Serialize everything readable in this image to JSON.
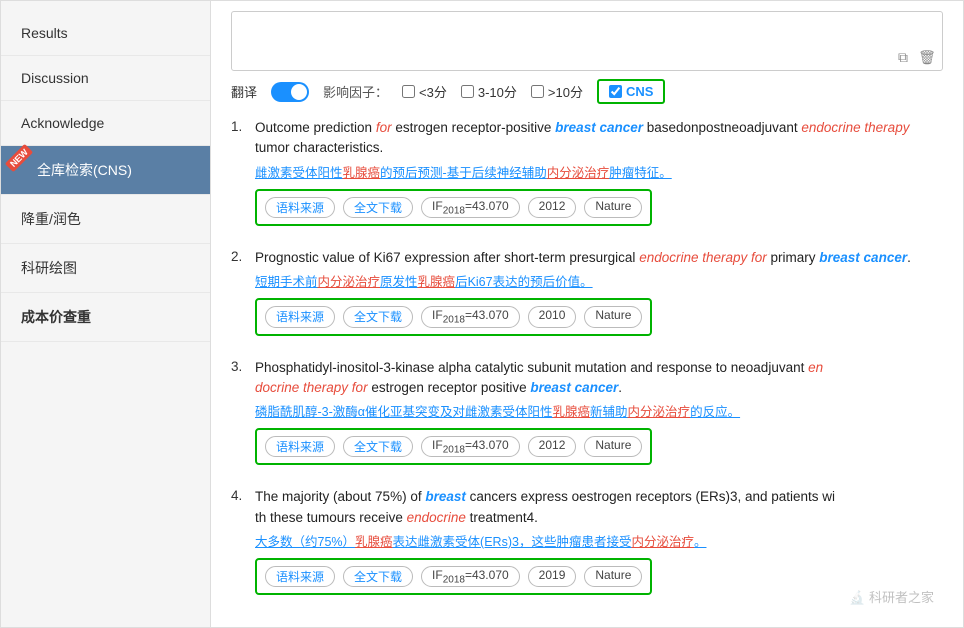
{
  "sidebar": {
    "items": [
      {
        "label": "Results",
        "active": false,
        "bold": false,
        "new": false
      },
      {
        "label": "Discussion",
        "active": false,
        "bold": false,
        "new": false
      },
      {
        "label": "Acknowledge",
        "active": false,
        "bold": false,
        "new": false
      },
      {
        "label": "全库检索(CNS)",
        "active": true,
        "bold": false,
        "new": true
      },
      {
        "label": "降重/润色",
        "active": false,
        "bold": false,
        "new": false
      },
      {
        "label": "科研绘图",
        "active": false,
        "bold": false,
        "new": false
      },
      {
        "label": "成本价查重",
        "active": false,
        "bold": true,
        "new": false
      }
    ]
  },
  "filter": {
    "translate_label": "翻译",
    "impact_label": "影响因子：",
    "lt3_label": "<3分",
    "range_label": "3-10分",
    "gt10_label": ">10分",
    "cns_label": "CNS",
    "cns_checked": true,
    "lt3_checked": false,
    "range_checked": false,
    "gt10_checked": false
  },
  "results": [
    {
      "title_before": "Outcome prediction ",
      "title_italic_red": "for",
      "title_mid1": " estrogen receptor-positive ",
      "title_italic_blue": "breast cancer",
      "title_mid2": " basedonpostneoadjuvant ",
      "title_red_italic": "endocrine therapy",
      "title_end": " tumor characteristics.",
      "cn_text": "雌激素受体阳性",
      "cn_red": "乳腺癌",
      "cn_mid": "的预后预测-基于后续神经辅助",
      "cn_red2": "内分泌治疗",
      "cn_end": "肿瘤特征。",
      "tags": [
        "语料来源",
        "全文下载",
        "IF2018=43.070",
        "2012",
        "Nature"
      ]
    },
    {
      "title_before": "Prognostic value of Ki67 expression after short-term presurgical ",
      "title_italic_red2": "endocrine therapy for",
      "title_mid1": " primary ",
      "title_italic_blue": "breast cancer",
      "title_end": ".",
      "cn_text": "短期手术前",
      "cn_red": "内分泌治疗",
      "cn_mid": "原发性",
      "cn_red2": "乳腺癌",
      "cn_end": "后Ki67表达的预后价值。",
      "tags": [
        "语料来源",
        "全文下载",
        "IF2018=43.070",
        "2010",
        "Nature"
      ]
    },
    {
      "title_before": "Phosphatidyl-inositol-3-kinase alpha catalytic subunit mutation and response to neoadjuvant ",
      "title_italic_red2": "en docrine therapy for",
      "title_mid1": " estrogen receptor positive ",
      "title_italic_blue": "breast cancer",
      "title_end": ".",
      "cn_text": "磷脂酰肌醇-3-激酶α催化亚基突变及对雌激素受体阳性",
      "cn_red2": "乳腺癌",
      "cn_mid2": "新辅助",
      "cn_red3": "内分泌治疗",
      "cn_end": "的反应。",
      "tags": [
        "语料来源",
        "全文下载",
        "IF2018=43.070",
        "2012",
        "Nature"
      ]
    },
    {
      "title_before": "The majority (about 75%) of ",
      "title_italic_blue": "breast",
      "title_mid1": " cancers express oestrogen receptors (ERs)3, and patients with these tumours receive ",
      "title_italic_red2": "endocrine",
      "title_end": " treatment4.",
      "cn_text": "大多数（约75%）",
      "cn_red": "乳腺癌",
      "cn_mid": "表达雌激素受体(ERs)3，这些肿瘤患者接受",
      "cn_red2": "内分泌治疗",
      "cn_end": "。",
      "tags": [
        "语料来源",
        "全文下载",
        "IF2018=43.070",
        "2019",
        "Nature"
      ]
    }
  ],
  "icons": {
    "copy": "⧉",
    "trash": "🗑",
    "watermark": "科研者之家"
  }
}
